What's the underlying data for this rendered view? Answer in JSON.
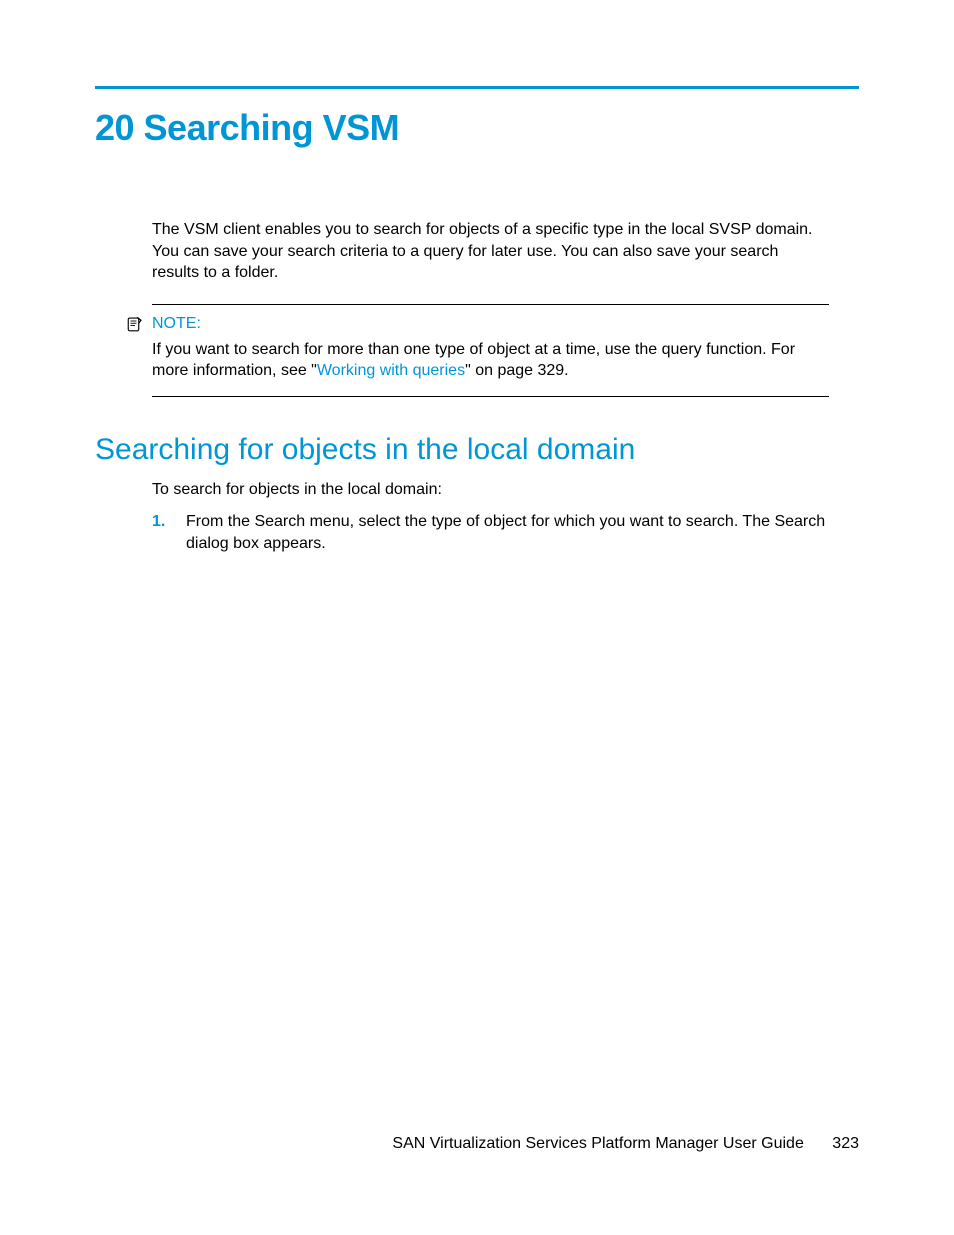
{
  "chapter": {
    "title": "20 Searching VSM"
  },
  "intro": "The VSM client enables you to search for objects of a specific type in the local SVSP domain. You can save your search criteria to a query for later use. You can also save your search results to a folder.",
  "note": {
    "label": "NOTE:",
    "body_prefix": "If you want to search for more than one type of object at a time, use the query function. For more information, see \"",
    "link_text": "Working with queries",
    "body_suffix": "\" on page 329."
  },
  "section": {
    "heading": "Searching for objects in the local domain",
    "intro": "To search for objects in the local domain:",
    "steps": [
      {
        "number": "1.",
        "text": "From the Search menu, select the type of object for which you want to search. The Search dialog box appears."
      }
    ]
  },
  "footer": {
    "doc_title": "SAN Virtualization Services Platform Manager User Guide",
    "page_number": "323"
  }
}
